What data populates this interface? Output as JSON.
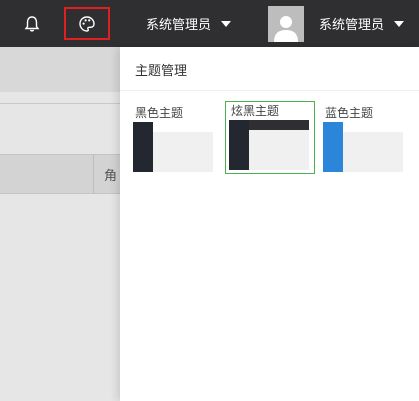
{
  "header": {
    "user_menu_left": "系统管理员",
    "user_menu_right": "系统管理员",
    "bell_icon": "bell-icon",
    "theme_icon": "palette-icon",
    "bg_color": "#2f2f31",
    "highlight_color": "#e02020"
  },
  "background_page": {
    "column_label": "角"
  },
  "drawer": {
    "title": "主题管理",
    "themes": [
      {
        "label": "黑色主题",
        "sidebar_color": "#222730",
        "topbar_color": "#ffffff",
        "selected": false
      },
      {
        "label": "炫黑主题",
        "sidebar_color": "#222730",
        "topbar_color": "#2f2f31",
        "selected": true
      },
      {
        "label": "蓝色主题",
        "sidebar_color": "#2b86d9",
        "topbar_color": "#ffffff",
        "selected": false
      }
    ],
    "selected_border_color": "#4caf50"
  }
}
